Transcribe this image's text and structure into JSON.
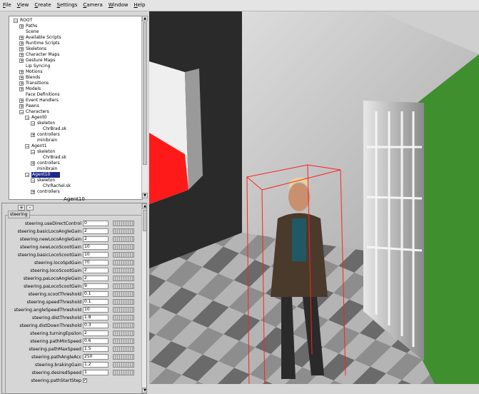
{
  "menu": [
    "File",
    "View",
    "Create",
    "Settings",
    "Camera",
    "Window",
    "Help"
  ],
  "tree": [
    {
      "label": "ROOT",
      "depth": 0,
      "box": "minus"
    },
    {
      "label": "Paths",
      "depth": 1,
      "box": "plus"
    },
    {
      "label": "Scene",
      "depth": 1,
      "box": "none"
    },
    {
      "label": "Available Scripts",
      "depth": 1,
      "box": "plus"
    },
    {
      "label": "Runtime Scripts",
      "depth": 1,
      "box": "plus"
    },
    {
      "label": "Skeletons",
      "depth": 1,
      "box": "plus"
    },
    {
      "label": "Character Maps",
      "depth": 1,
      "box": "plus"
    },
    {
      "label": "Gesture Maps",
      "depth": 1,
      "box": "plus"
    },
    {
      "label": "Lip Syncing",
      "depth": 1,
      "box": "none"
    },
    {
      "label": "Motions",
      "depth": 1,
      "box": "plus"
    },
    {
      "label": "Blends",
      "depth": 1,
      "box": "plus"
    },
    {
      "label": "Transitions",
      "depth": 1,
      "box": "plus"
    },
    {
      "label": "Models",
      "depth": 1,
      "box": "plus"
    },
    {
      "label": "Face Definitions",
      "depth": 1,
      "box": "none"
    },
    {
      "label": "Event Handlers",
      "depth": 1,
      "box": "plus"
    },
    {
      "label": "Pawns",
      "depth": 1,
      "box": "plus"
    },
    {
      "label": "Characters",
      "depth": 1,
      "box": "minus"
    },
    {
      "label": "Agent0",
      "depth": 2,
      "box": "minus"
    },
    {
      "label": "skeleton",
      "depth": 3,
      "box": "minus"
    },
    {
      "label": "ChrBrad.sk",
      "depth": 4,
      "box": "none"
    },
    {
      "label": "controllers",
      "depth": 3,
      "box": "plus"
    },
    {
      "label": "minibrain",
      "depth": 3,
      "box": "none"
    },
    {
      "label": "Agent1",
      "depth": 2,
      "box": "minus"
    },
    {
      "label": "skeleton",
      "depth": 3,
      "box": "minus"
    },
    {
      "label": "ChrBrad.sk",
      "depth": 4,
      "box": "none"
    },
    {
      "label": "controllers",
      "depth": 3,
      "box": "plus"
    },
    {
      "label": "minibrain",
      "depth": 3,
      "box": "none"
    },
    {
      "label": "Agent10",
      "depth": 2,
      "box": "minus",
      "selected": true
    },
    {
      "label": "skeleton",
      "depth": 3,
      "box": "minus"
    },
    {
      "label": "ChrRachel.sk",
      "depth": 4,
      "box": "none"
    },
    {
      "label": "controllers",
      "depth": 3,
      "box": "plus"
    }
  ],
  "agent_header": "Agent10",
  "buttons": {
    "plus": "+",
    "minus": "-"
  },
  "group_label": "steering",
  "attributes": [
    {
      "label": "steering.useDirectControl",
      "value": "0"
    },
    {
      "label": "steering.basicLocoAngleGain",
      "value": "2"
    },
    {
      "label": "steering.newLocoAngleGain",
      "value": "2"
    },
    {
      "label": "steering.newLocoScootGain",
      "value": "10"
    },
    {
      "label": "steering.basicLocoScootGain",
      "value": "10"
    },
    {
      "label": "steering.locoSpdGain",
      "value": "70"
    },
    {
      "label": "steering.locoScootGain",
      "value": "2"
    },
    {
      "label": "steering.paLocoAngleGain",
      "value": "2"
    },
    {
      "label": "steering.paLocoScootGain",
      "value": "9"
    },
    {
      "label": "steering.scootThreshold",
      "value": "0.1"
    },
    {
      "label": "steering.speedThreshold",
      "value": "0.1"
    },
    {
      "label": "steering.angleSpeedThreshold",
      "value": "10"
    },
    {
      "label": "steering.distThreshold",
      "value": "1.8"
    },
    {
      "label": "steering.distDownThreshold",
      "value": "0.3"
    },
    {
      "label": "steering.turningEpsilon",
      "value": "2"
    },
    {
      "label": "steering.pathMinSpeed",
      "value": "0.6"
    },
    {
      "label": "steering.pathMaxSpeed",
      "value": "1.5"
    },
    {
      "label": "steering.pathAngleAcc",
      "value": "250"
    },
    {
      "label": "steering.brakingGain",
      "value": "1.2"
    },
    {
      "label": "steering.desiredSpeed",
      "value": "1"
    },
    {
      "label": "steering.pathStartStep",
      "value": "",
      "checkbox": true,
      "checked": true
    }
  ],
  "colors": {
    "selection": "#1d2a8c",
    "floor_light": "#9a9a9a",
    "floor_dark": "#6e6e6e",
    "grass": "#3f8f2f",
    "red": "#ff1a1a"
  },
  "icons": [
    "scroll-up-arrow-icon",
    "scroll-down-arrow-icon"
  ]
}
